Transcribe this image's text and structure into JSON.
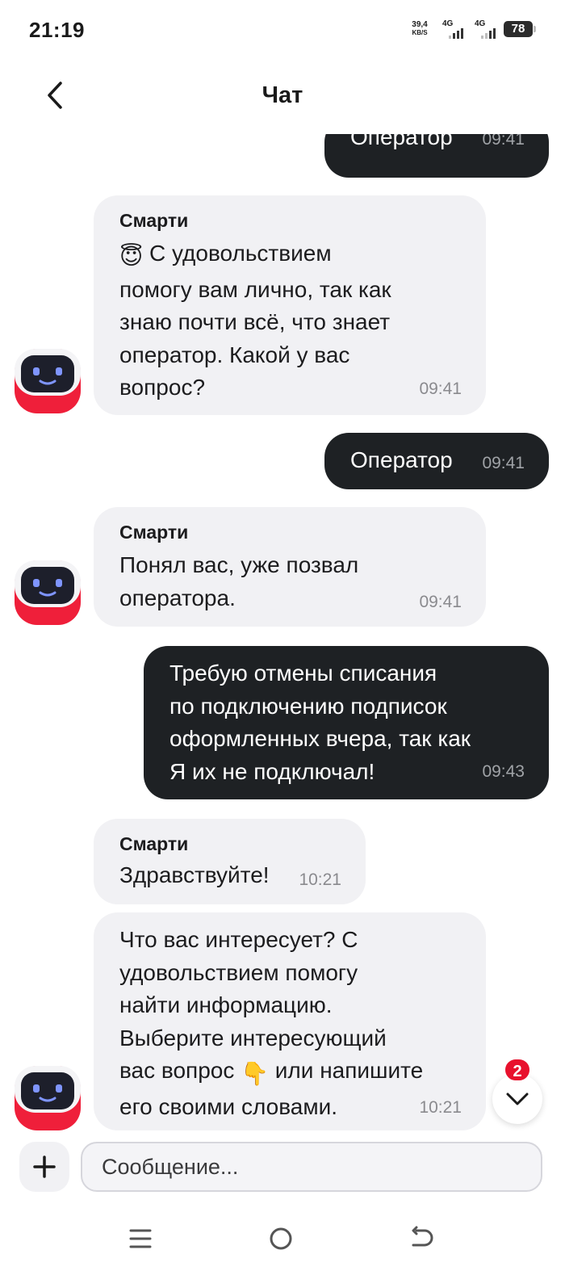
{
  "status_bar": {
    "time": "21:19",
    "net_speed_value": "39,4",
    "net_speed_unit": "KB/S",
    "signal1_label": "4G",
    "signal2_label": "4G",
    "battery": "78"
  },
  "header": {
    "title": "Чат",
    "back_icon": "chevron-left-icon"
  },
  "messages": [
    {
      "direction": "out",
      "text": "Оператор",
      "time": "09:41"
    },
    {
      "direction": "in",
      "sender": "Смарти",
      "emoji": "😇",
      "text": "С удовольствием\nпомогу вам лично, так как\nзнаю почти всё, что знает\nоператор. Какой у вас\nвопрос?",
      "time": "09:41"
    },
    {
      "direction": "out",
      "text": "Оператор",
      "time": "09:41"
    },
    {
      "direction": "in",
      "sender": "Смарти",
      "text": "Понял вас, уже позвал\nоператора.",
      "time": "09:41"
    },
    {
      "direction": "out",
      "text": "Требую отмены списания\nпо подключению подписок\nоформленных вчера, так как\nЯ их не подключал!",
      "time": "09:43"
    },
    {
      "direction": "in",
      "sender": "Смарти",
      "text": "Здравствуйте!",
      "time": "10:21"
    },
    {
      "direction": "in",
      "text_part1": "Что вас интересует? С\nудовольствием помогу\nнайти информацию.\nВыберите интересующий\nвас вопрос ",
      "emoji": "👇",
      "text_part2": " или напишите\nего своими словами.",
      "time": "10:21"
    }
  ],
  "scroll_down": {
    "unread_count": "2",
    "icon": "chevron-down-icon"
  },
  "composer": {
    "placeholder": "Сообщение...",
    "add_icon": "plus-icon"
  },
  "nav_bar": {
    "icons": [
      "menu-icon",
      "home-icon",
      "back-icon"
    ]
  },
  "colors": {
    "outgoing_bubble": "#1e2124",
    "incoming_bubble": "#f1f1f4",
    "accent_red": "#e8112d"
  }
}
